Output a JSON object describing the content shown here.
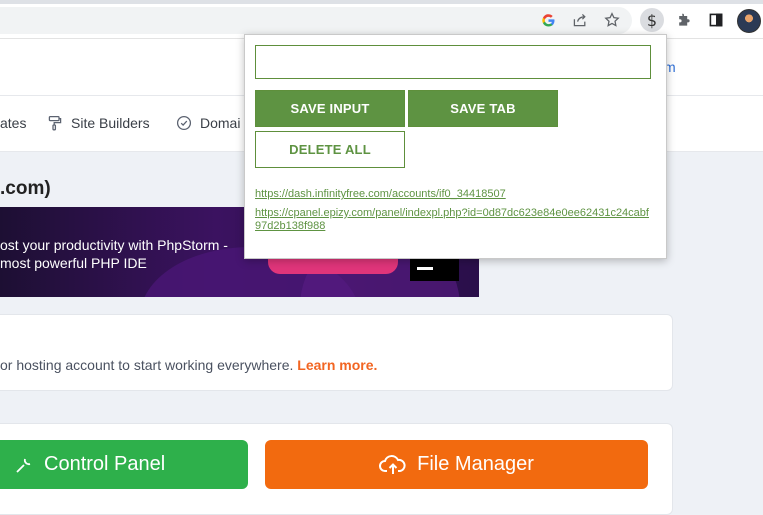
{
  "browser": {
    "toolbar_icons": [
      "google-icon",
      "share-icon",
      "star-icon",
      "dollar-extension-icon",
      "puzzle-icon",
      "side-panel-icon",
      "avatar"
    ]
  },
  "page": {
    "header_link_text": "m",
    "nav": [
      {
        "label": "ates",
        "icon": "templates-icon"
      },
      {
        "label": "Site Builders",
        "icon": "paint-roller-icon"
      },
      {
        "label": "Domai",
        "icon": "check-circle-icon"
      }
    ],
    "domain_title": ".com)",
    "promo": {
      "line1": "ost your productivity with PhpStorm -",
      "line2": " most powerful PHP IDE"
    },
    "info_card": {
      "text": "or hosting account to start working everywhere.",
      "link": "Learn more."
    },
    "buttons": {
      "control_panel": "Control Panel",
      "file_manager": "File Manager"
    }
  },
  "popup": {
    "input_value": "",
    "input_placeholder": "",
    "save_input_label": "SAVE INPUT",
    "save_tab_label": "SAVE TAB",
    "delete_all_label": "DELETE ALL",
    "links": [
      "https://dash.infinityfree.com/accounts/if0_34418507",
      "https://cpanel.epizy.com/panel/indexpl.php?id=0d87dc623e84e0ee62431c24cabf97d2b138f988"
    ],
    "colors": {
      "accent": "#5e9342",
      "border": "#5e8f3b"
    }
  }
}
